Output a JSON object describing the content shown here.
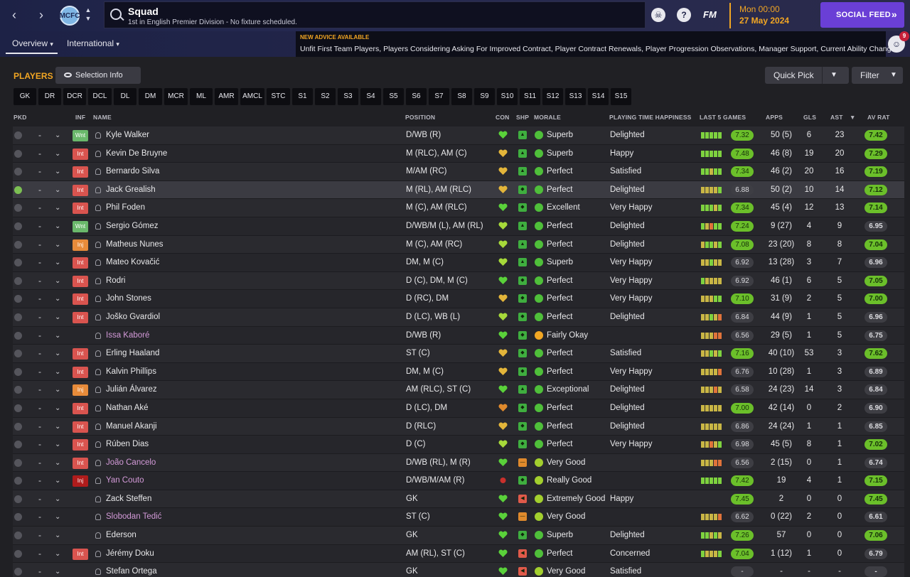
{
  "header": {
    "search_title": "Squad",
    "search_subtitle": "1st in English Premier Division - No fixture scheduled.",
    "fm_logo": "FM",
    "date_time": "Mon 00:00",
    "date_date": "27 May 2024",
    "social_feed_label": "SOCIAL FEED",
    "help_icon_glyph": "?",
    "club_badge_text": "MCFC"
  },
  "subnav": {
    "tabs": [
      {
        "label": "Overview",
        "chev": "⌄"
      },
      {
        "label": "International",
        "chev": "⌄"
      }
    ],
    "advice_title": "NEW ADVICE AVAILABLE",
    "advice_text": "Unfit First Team Players, Players Considering Asking For Improved Contract, Player Contract Renewals, Player Progression Observations, Manager Support, Current Ability Changes",
    "advice_count": "9"
  },
  "panel": {
    "title": "PLAYERS",
    "selection_info": "Selection Info",
    "quick_pick": "Quick Pick",
    "filter": "Filter"
  },
  "positions": [
    "GK",
    "DR",
    "DCR",
    "DCL",
    "DL",
    "DM",
    "MCR",
    "ML",
    "AMR",
    "AMCL",
    "STC",
    "S1",
    "S2",
    "S3",
    "S4",
    "S5",
    "S6",
    "S7",
    "S8",
    "S9",
    "S10",
    "S11",
    "S12",
    "S13",
    "S14",
    "S15"
  ],
  "columns": {
    "pkd": "PKD",
    "inf": "INF",
    "name": "NAME",
    "position": "POSITION",
    "con": "CON",
    "shp": "SHP",
    "morale": "MORALE",
    "pth": "PLAYING TIME HAPPINESS",
    "last5": "LAST 5 GAMES",
    "apps": "APPS",
    "gls": "GLS",
    "ast": "AST",
    "avrat": "AV RAT",
    "sort_indicator": "▼"
  },
  "colors": {
    "accent_orange": "#f2a623",
    "social_purple": "#6a3fd6",
    "rating_green": "#6bbf2a",
    "loan_name": "#d39ad8"
  },
  "players": [
    {
      "picked": false,
      "dash": "-",
      "inf": "Wnt",
      "name": "Kyle Walker",
      "loan": false,
      "position": "D/WB (R)",
      "con": "green",
      "shp": "green-up",
      "morale_icon": "green",
      "morale": "Superb",
      "pth": "Delighted",
      "form": [
        "g",
        "g",
        "g",
        "g",
        "g"
      ],
      "form_rating": "7.32",
      "form_good": true,
      "apps": "50 (5)",
      "gls": "6",
      "ast": "23",
      "avrat": "7.42",
      "avrat_good": true
    },
    {
      "picked": false,
      "dash": "-",
      "inf": "Int",
      "name": "Kevin De Bruyne",
      "loan": false,
      "position": "M (RLC), AM (C)",
      "con": "yellow",
      "shp": "green-up",
      "morale_icon": "green",
      "morale": "Superb",
      "pth": "Happy",
      "form": [
        "g",
        "g",
        "g",
        "g",
        "g"
      ],
      "form_rating": "7.48",
      "form_good": true,
      "apps": "46 (8)",
      "gls": "19",
      "ast": "20",
      "avrat": "7.29",
      "avrat_good": true
    },
    {
      "picked": false,
      "dash": "-",
      "inf": "Int",
      "name": "Bernardo Silva",
      "loan": false,
      "position": "M/AM (RC)",
      "con": "yellow",
      "shp": "green-up",
      "morale_icon": "green",
      "morale": "Perfect",
      "pth": "Satisfied",
      "form": [
        "g",
        "g",
        "y",
        "g",
        "g"
      ],
      "form_rating": "7.34",
      "form_good": true,
      "apps": "46 (2)",
      "gls": "20",
      "ast": "16",
      "avrat": "7.19",
      "avrat_good": true
    },
    {
      "picked": true,
      "dash": "-",
      "inf": "Int",
      "name": "Jack Grealish",
      "loan": false,
      "position": "M (RL), AM (RLC)",
      "con": "yellow",
      "shp": "green",
      "morale_icon": "green",
      "morale": "Perfect",
      "pth": "Delighted",
      "form": [
        "y",
        "y",
        "y",
        "y",
        "g"
      ],
      "form_rating": "6.88",
      "form_good": false,
      "apps": "50 (2)",
      "gls": "10",
      "ast": "14",
      "avrat": "7.12",
      "avrat_good": true
    },
    {
      "picked": false,
      "dash": "-",
      "inf": "Int",
      "name": "Phil Foden",
      "loan": false,
      "position": "M (C), AM (RLC)",
      "con": "green",
      "shp": "green",
      "morale_icon": "green",
      "morale": "Excellent",
      "pth": "Very Happy",
      "form": [
        "g",
        "g",
        "g",
        "y",
        "g"
      ],
      "form_rating": "7.34",
      "form_good": true,
      "apps": "45 (4)",
      "gls": "12",
      "ast": "13",
      "avrat": "7.14",
      "avrat_good": true
    },
    {
      "picked": false,
      "dash": "-",
      "inf": "Wnt",
      "name": "Sergio Gómez",
      "loan": false,
      "position": "D/WB/M (L), AM (RL)",
      "con": "lime",
      "shp": "green-up",
      "morale_icon": "green",
      "morale": "Perfect",
      "pth": "Delighted",
      "form": [
        "g",
        "y",
        "o",
        "g",
        "g"
      ],
      "form_rating": "7.24",
      "form_good": true,
      "apps": "9 (27)",
      "gls": "4",
      "ast": "9",
      "avrat": "6.95",
      "avrat_good": false
    },
    {
      "picked": false,
      "dash": "-",
      "inf": "Inj",
      "name": "Matheus Nunes",
      "loan": false,
      "position": "M (C), AM (RC)",
      "con": "lime",
      "shp": "green-up",
      "morale_icon": "green",
      "morale": "Perfect",
      "pth": "Delighted",
      "form": [
        "y",
        "g",
        "g",
        "y",
        "g"
      ],
      "form_rating": "7.08",
      "form_good": true,
      "apps": "23 (20)",
      "gls": "8",
      "ast": "8",
      "avrat": "7.04",
      "avrat_good": true
    },
    {
      "picked": false,
      "dash": "-",
      "inf": "Int",
      "name": "Mateo Kovačić",
      "loan": false,
      "position": "DM, M (C)",
      "con": "lime",
      "shp": "green-up",
      "morale_icon": "green",
      "morale": "Superb",
      "pth": "Very Happy",
      "form": [
        "y",
        "y",
        "g",
        "y",
        "y"
      ],
      "form_rating": "6.92",
      "form_good": false,
      "apps": "13 (28)",
      "gls": "3",
      "ast": "7",
      "avrat": "6.96",
      "avrat_good": false
    },
    {
      "picked": false,
      "dash": "-",
      "inf": "Int",
      "name": "Rodri",
      "loan": false,
      "position": "D (C), DM, M (C)",
      "con": "green",
      "shp": "green",
      "morale_icon": "green",
      "morale": "Perfect",
      "pth": "Very Happy",
      "form": [
        "g",
        "y",
        "y",
        "y",
        "y"
      ],
      "form_rating": "6.92",
      "form_good": false,
      "apps": "46 (1)",
      "gls": "6",
      "ast": "5",
      "avrat": "7.05",
      "avrat_good": true
    },
    {
      "picked": false,
      "dash": "-",
      "inf": "Int",
      "name": "John Stones",
      "loan": false,
      "position": "D (RC), DM",
      "con": "yellow",
      "shp": "green",
      "morale_icon": "green",
      "morale": "Perfect",
      "pth": "Very Happy",
      "form": [
        "y",
        "y",
        "y",
        "g",
        "g"
      ],
      "form_rating": "7.10",
      "form_good": true,
      "apps": "31 (9)",
      "gls": "2",
      "ast": "5",
      "avrat": "7.00",
      "avrat_good": true
    },
    {
      "picked": false,
      "dash": "-",
      "inf": "Int",
      "name": "Joško Gvardiol",
      "loan": false,
      "position": "D (LC), WB (L)",
      "con": "lime",
      "shp": "green",
      "morale_icon": "green",
      "morale": "Perfect",
      "pth": "Delighted",
      "form": [
        "y",
        "y",
        "g",
        "y",
        "o"
      ],
      "form_rating": "6.84",
      "form_good": false,
      "apps": "44 (9)",
      "gls": "1",
      "ast": "5",
      "avrat": "6.96",
      "avrat_good": false
    },
    {
      "picked": false,
      "dash": "-",
      "inf": "",
      "name": "Issa Kaboré",
      "loan": true,
      "position": "D/WB (R)",
      "con": "green",
      "shp": "green",
      "morale_icon": "yellow",
      "morale": "Fairly Okay",
      "pth": "",
      "form": [
        "y",
        "y",
        "y",
        "o",
        "o"
      ],
      "form_rating": "6.56",
      "form_good": false,
      "apps": "29 (5)",
      "gls": "1",
      "ast": "5",
      "avrat": "6.75",
      "avrat_good": false
    },
    {
      "picked": false,
      "dash": "-",
      "inf": "Int",
      "name": "Erling Haaland",
      "loan": false,
      "position": "ST (C)",
      "con": "yellow",
      "shp": "green",
      "morale_icon": "green",
      "morale": "Perfect",
      "pth": "Satisfied",
      "form": [
        "y",
        "y",
        "g",
        "y",
        "g"
      ],
      "form_rating": "7.16",
      "form_good": true,
      "apps": "40 (10)",
      "gls": "53",
      "ast": "3",
      "avrat": "7.62",
      "avrat_good": true
    },
    {
      "picked": false,
      "dash": "-",
      "inf": "Int",
      "name": "Kalvin Phillips",
      "loan": false,
      "position": "DM, M (C)",
      "con": "yellow",
      "shp": "green",
      "morale_icon": "green",
      "morale": "Perfect",
      "pth": "Very Happy",
      "form": [
        "y",
        "y",
        "y",
        "y",
        "o"
      ],
      "form_rating": "6.76",
      "form_good": false,
      "apps": "10 (28)",
      "gls": "1",
      "ast": "3",
      "avrat": "6.89",
      "avrat_good": false
    },
    {
      "picked": false,
      "dash": "-",
      "inf": "Inj",
      "name": "Julián Álvarez",
      "loan": false,
      "position": "AM (RLC), ST (C)",
      "con": "green",
      "shp": "green-up",
      "morale_icon": "green",
      "morale": "Exceptional",
      "pth": "Delighted",
      "form": [
        "y",
        "y",
        "y",
        "o",
        "y"
      ],
      "form_rating": "6.58",
      "form_good": false,
      "apps": "24 (23)",
      "gls": "14",
      "ast": "3",
      "avrat": "6.84",
      "avrat_good": false
    },
    {
      "picked": false,
      "dash": "-",
      "inf": "Int",
      "name": "Nathan Aké",
      "loan": false,
      "position": "D (LC), DM",
      "con": "orange",
      "shp": "green",
      "morale_icon": "green",
      "morale": "Perfect",
      "pth": "Delighted",
      "form": [
        "y",
        "y",
        "y",
        "y",
        "y"
      ],
      "form_rating": "7.00",
      "form_good": true,
      "apps": "42 (14)",
      "gls": "0",
      "ast": "2",
      "avrat": "6.90",
      "avrat_good": false
    },
    {
      "picked": false,
      "dash": "-",
      "inf": "Int",
      "name": "Manuel Akanji",
      "loan": false,
      "position": "D (RLC)",
      "con": "yellow",
      "shp": "green",
      "morale_icon": "green",
      "morale": "Perfect",
      "pth": "Delighted",
      "form": [
        "y",
        "y",
        "y",
        "y",
        "y"
      ],
      "form_rating": "6.86",
      "form_good": false,
      "apps": "24 (24)",
      "gls": "1",
      "ast": "1",
      "avrat": "6.85",
      "avrat_good": false
    },
    {
      "picked": false,
      "dash": "-",
      "inf": "Int",
      "name": "Rúben Dias",
      "loan": false,
      "position": "D (C)",
      "con": "lime",
      "shp": "green",
      "morale_icon": "green",
      "morale": "Perfect",
      "pth": "Very Happy",
      "form": [
        "y",
        "y",
        "o",
        "y",
        "g"
      ],
      "form_rating": "6.98",
      "form_good": false,
      "apps": "45 (5)",
      "gls": "8",
      "ast": "1",
      "avrat": "7.02",
      "avrat_good": true
    },
    {
      "picked": false,
      "dash": "-",
      "inf": "Int",
      "name": "João Cancelo",
      "loan": true,
      "position": "D/WB (RL), M (R)",
      "con": "green",
      "shp": "orange",
      "morale_icon": "lime",
      "morale": "Very Good",
      "pth": "",
      "form": [
        "y",
        "y",
        "y",
        "o",
        "o"
      ],
      "form_rating": "6.56",
      "form_good": false,
      "apps": "2 (15)",
      "gls": "0",
      "ast": "1",
      "avrat": "6.74",
      "avrat_good": false
    },
    {
      "picked": false,
      "dash": "-",
      "inf": "Inj",
      "name": "Yan Couto",
      "loan": true,
      "position": "D/WB/M/AM (R)",
      "con": "red",
      "shp": "green",
      "morale_icon": "lime",
      "morale": "Really Good",
      "pth": "",
      "form": [
        "g",
        "g",
        "g",
        "g",
        "g"
      ],
      "form_rating": "7.42",
      "form_good": true,
      "apps": "19",
      "gls": "4",
      "ast": "1",
      "avrat": "7.15",
      "avrat_good": true
    },
    {
      "picked": false,
      "dash": "-",
      "inf": "",
      "name": "Zack Steffen",
      "loan": false,
      "position": "GK",
      "con": "green",
      "shp": "red",
      "morale_icon": "lime",
      "morale": "Extremely Good",
      "pth": "Happy",
      "form": [],
      "form_rating": "7.45",
      "form_good": true,
      "apps": "2",
      "gls": "0",
      "ast": "0",
      "avrat": "7.45",
      "avrat_good": true
    },
    {
      "picked": false,
      "dash": "-",
      "inf": "",
      "name": "Slobodan Tedić",
      "loan": true,
      "position": "ST (C)",
      "con": "green",
      "shp": "orange",
      "morale_icon": "lime",
      "morale": "Very Good",
      "pth": "",
      "form": [
        "y",
        "y",
        "y",
        "y",
        "o"
      ],
      "form_rating": "6.62",
      "form_good": false,
      "apps": "0 (22)",
      "gls": "2",
      "ast": "0",
      "avrat": "6.61",
      "avrat_good": false
    },
    {
      "picked": false,
      "dash": "-",
      "inf": "",
      "name": "Ederson",
      "loan": false,
      "position": "GK",
      "con": "green",
      "shp": "green",
      "morale_icon": "green",
      "morale": "Superb",
      "pth": "Delighted",
      "form": [
        "g",
        "g",
        "y",
        "g",
        "y"
      ],
      "form_rating": "7.26",
      "form_good": true,
      "apps": "57",
      "gls": "0",
      "ast": "0",
      "avrat": "7.06",
      "avrat_good": true
    },
    {
      "picked": false,
      "dash": "-",
      "inf": "Int",
      "name": "Jérémy Doku",
      "loan": false,
      "position": "AM (RL), ST (C)",
      "con": "green",
      "shp": "red",
      "morale_icon": "green",
      "morale": "Perfect",
      "pth": "Concerned",
      "form": [
        "g",
        "y",
        "y",
        "y",
        "g"
      ],
      "form_rating": "7.04",
      "form_good": true,
      "apps": "1 (12)",
      "gls": "1",
      "ast": "0",
      "avrat": "6.79",
      "avrat_good": false
    },
    {
      "picked": false,
      "dash": "-",
      "inf": "",
      "name": "Stefan Ortega",
      "loan": false,
      "position": "GK",
      "con": "green",
      "shp": "red",
      "morale_icon": "lime",
      "morale": "Very Good",
      "pth": "Satisfied",
      "form": [],
      "form_rating": "-",
      "form_good": false,
      "apps": "-",
      "gls": "-",
      "ast": "-",
      "avrat": "-",
      "avrat_good": false
    }
  ]
}
